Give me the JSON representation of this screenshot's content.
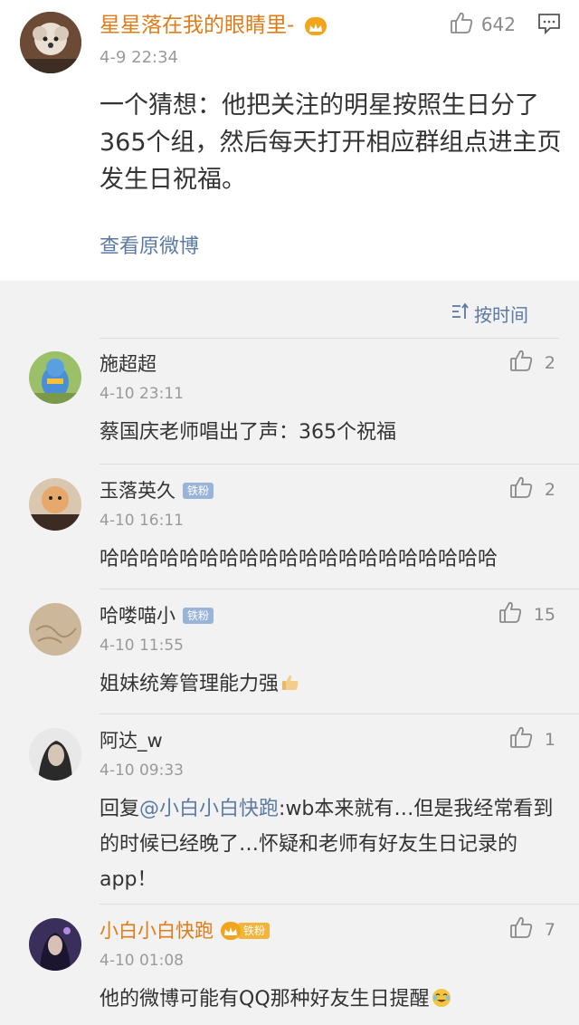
{
  "post": {
    "author": "星星落在我的眼睛里-",
    "time": "4-9 22:34",
    "likes": "642",
    "text": "一个猜想：他把关注的明星按照生日分了365个组，然后每天打开相应群组点进主页发生日祝福。",
    "view_original": "查看原微博"
  },
  "sort": {
    "label": "按时间"
  },
  "comments": [
    {
      "name": "施超超",
      "time": "4-10 23:11",
      "likes": "2",
      "text": "蔡国庆老师唱出了声：365个祝福"
    },
    {
      "name": "玉落英久",
      "badge": "铁粉",
      "time": "4-10 16:11",
      "likes": "2",
      "text": "哈哈哈哈哈哈哈哈哈哈哈哈哈哈哈哈哈哈哈哈"
    },
    {
      "name": "哈喽喵小",
      "badge": "铁粉",
      "time": "4-10 11:55",
      "likes": "15",
      "text": "姐妹统筹管理能力强"
    },
    {
      "name": "阿达_w",
      "time": "4-10 09:33",
      "likes": "1",
      "reply_prefix": "回复",
      "mention": "@小白小白快跑",
      "text": ":wb本来就有…但是我经常看到的时候已经晚了…怀疑和老师有好友生日记录的app！"
    },
    {
      "name": "小白小白快跑",
      "badge": "铁粉",
      "time": "4-10 01:08",
      "likes": "7",
      "text": "他的微博可能有QQ那种好友生日提醒"
    }
  ],
  "colors": {
    "vip_orange": "#e07c18",
    "link_blue": "#5b7aa3",
    "fan_badge": "#9ab3d8",
    "background": "#f2f2f2"
  },
  "icons": [
    "thumbs-up-icon",
    "comment-icon",
    "sort-icon",
    "crown-icon"
  ]
}
